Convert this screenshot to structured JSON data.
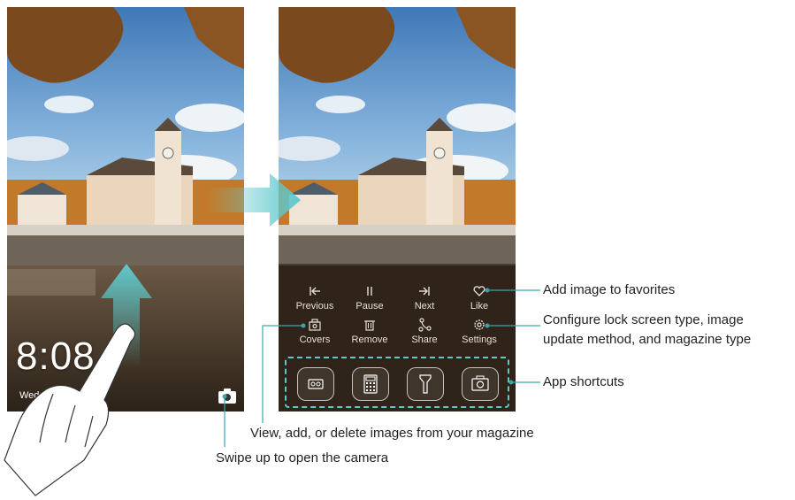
{
  "lockscreen": {
    "time": "8:08",
    "date": "Wed."
  },
  "magazine_controls": [
    {
      "label": "Previous",
      "icon": "previous-icon"
    },
    {
      "label": "Pause",
      "icon": "pause-icon"
    },
    {
      "label": "Next",
      "icon": "next-icon"
    },
    {
      "label": "Like",
      "icon": "heart-icon"
    },
    {
      "label": "Covers",
      "icon": "covers-icon"
    },
    {
      "label": "Remove",
      "icon": "trash-icon"
    },
    {
      "label": "Share",
      "icon": "share-icon"
    },
    {
      "label": "Settings",
      "icon": "gear-icon"
    }
  ],
  "app_shortcuts": [
    "voice-recorder-icon",
    "calculator-icon",
    "flashlight-icon",
    "camera-icon"
  ],
  "annotations": {
    "favorites": "Add image to favorites",
    "configure_line1": "Configure lock screen type, image",
    "configure_line2": "update method, and magazine type",
    "shortcuts": "App shortcuts",
    "images": "View, add, or delete images from your magazine",
    "camera": "Swipe up to open the camera"
  },
  "colors": {
    "accent": "#5ec8cc",
    "callout": "#3aa6a8"
  }
}
